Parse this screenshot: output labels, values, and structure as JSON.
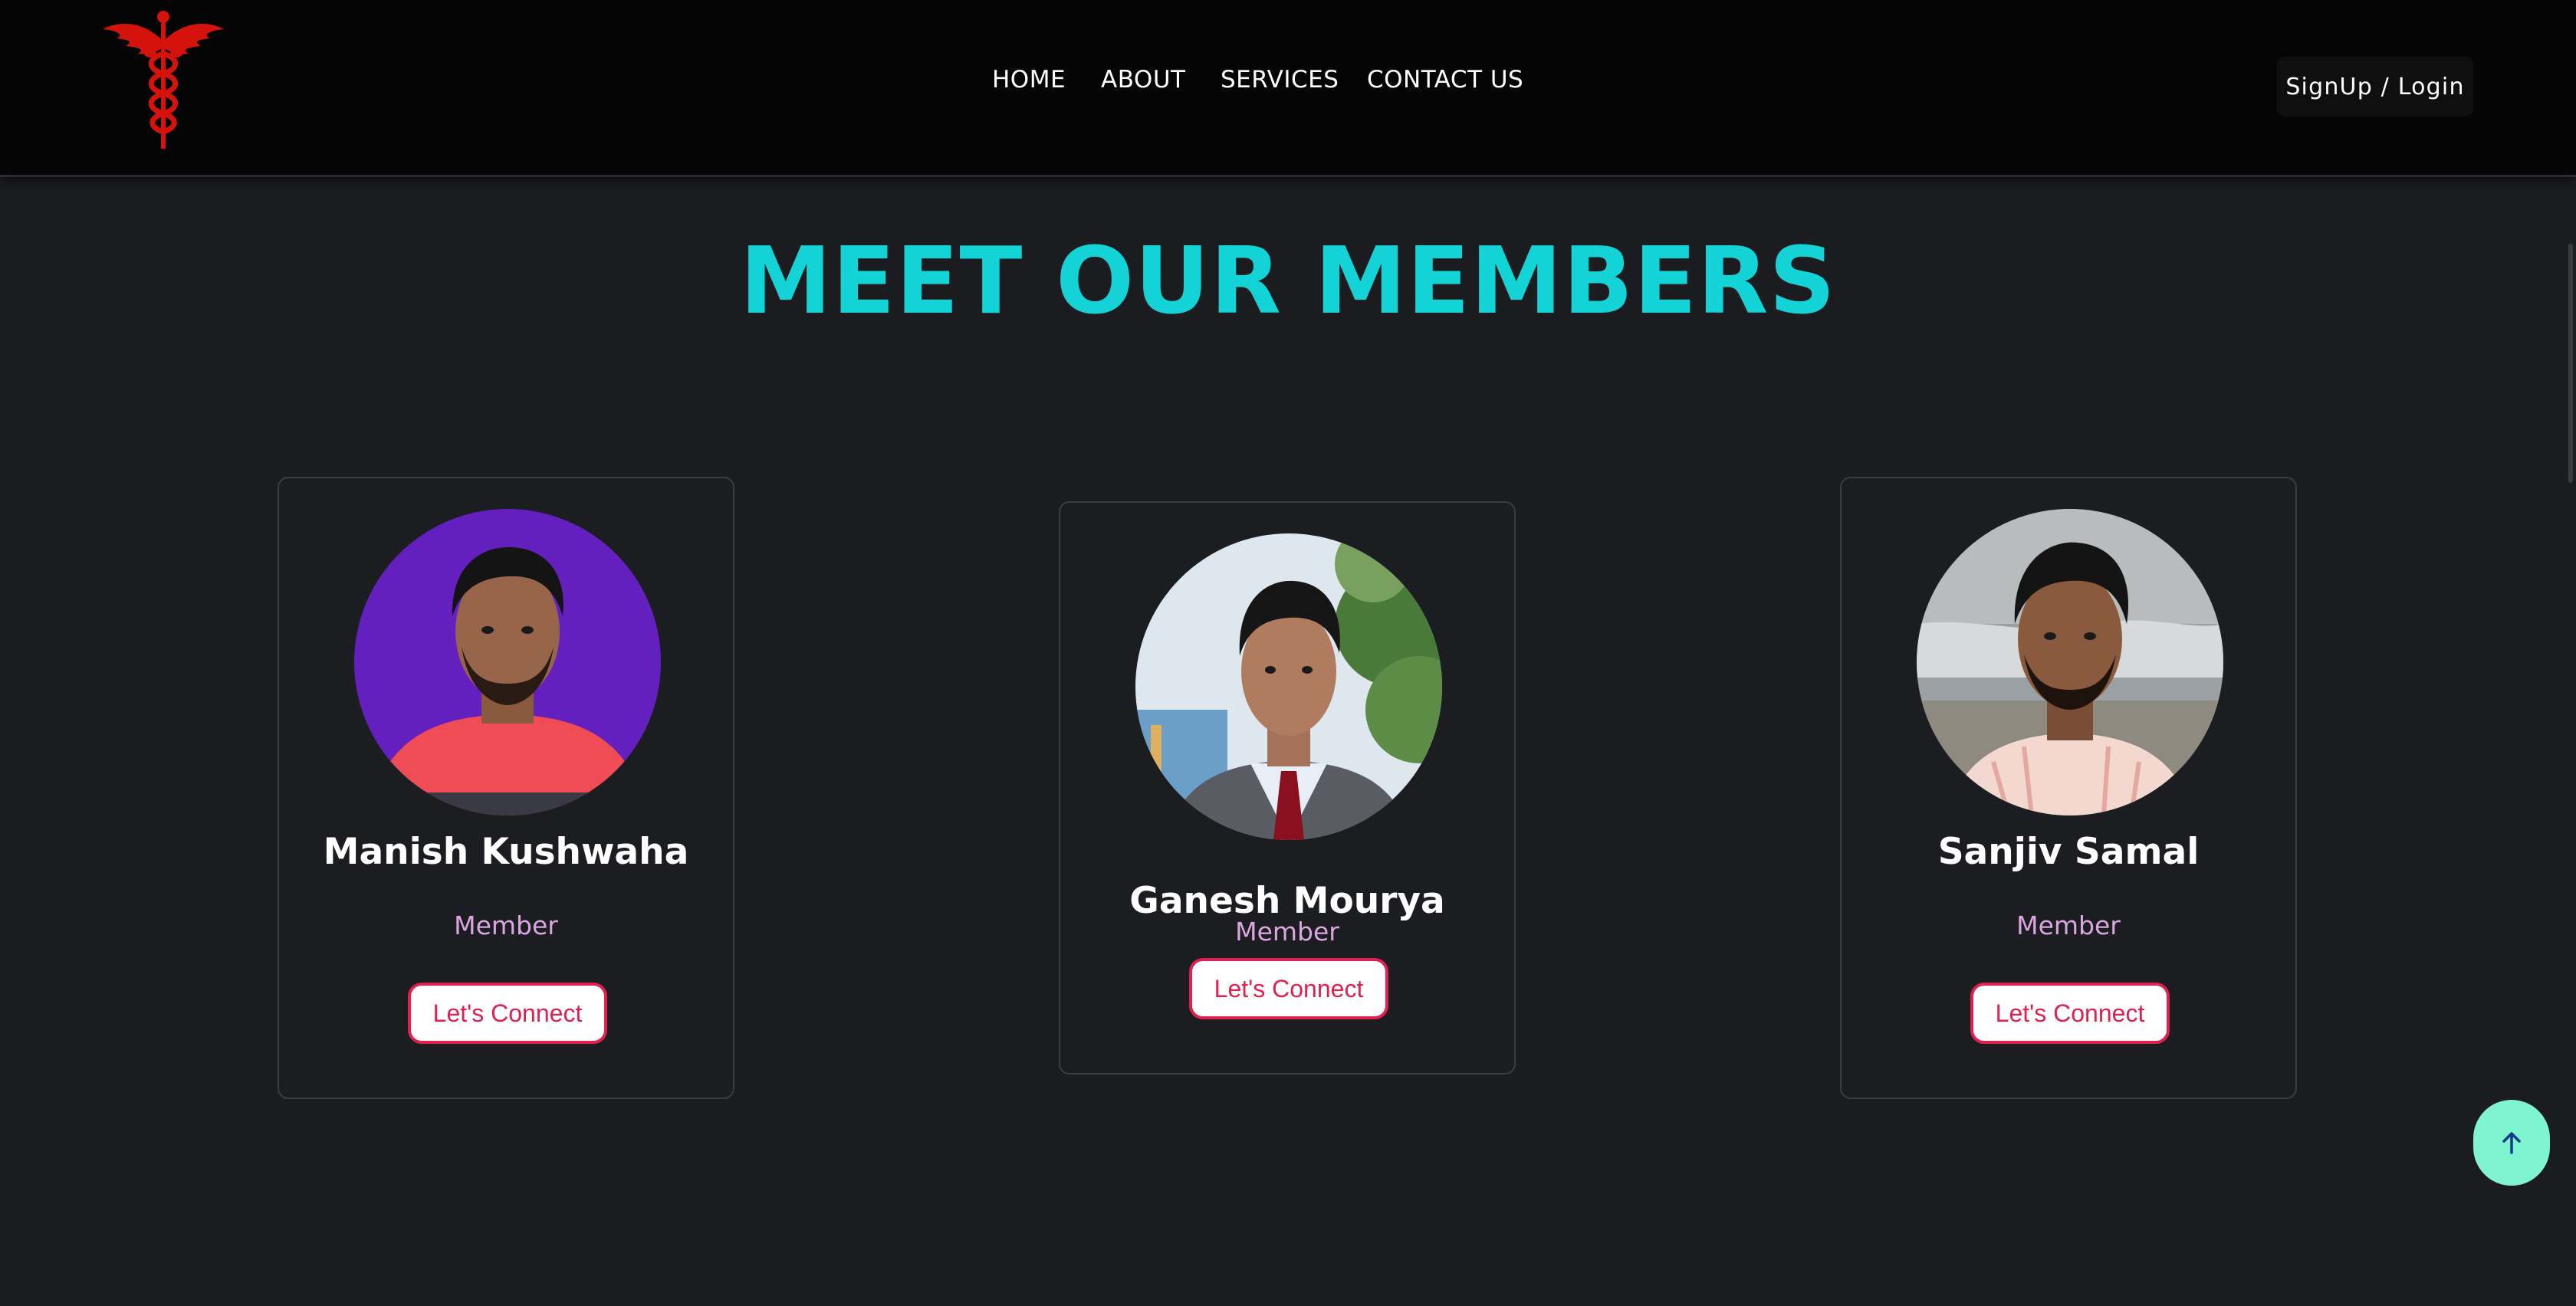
{
  "nav": {
    "links": [
      "HOME",
      "ABOUT",
      "SERVICES",
      "CONTACT US"
    ],
    "signup_label": "SignUp / Login"
  },
  "page": {
    "title": "MEET OUR MEMBERS"
  },
  "members": [
    {
      "name": "Manish Kushwaha",
      "role": "Member",
      "button": "Let's Connect"
    },
    {
      "name": "Ganesh Mourya",
      "role": "Member",
      "button": "Let's Connect"
    },
    {
      "name": "Sanjiv Samal",
      "role": "Member",
      "button": "Let's Connect"
    }
  ],
  "colors": {
    "accent": "#14d3d6",
    "button_border": "#e0204f",
    "role_text": "#d9a6e0",
    "scroll_top_bg": "#7ef4cf",
    "logo": "#d4140c"
  },
  "icons": {
    "logo": "caduceus-icon",
    "scroll_top": "arrow-up-icon"
  }
}
